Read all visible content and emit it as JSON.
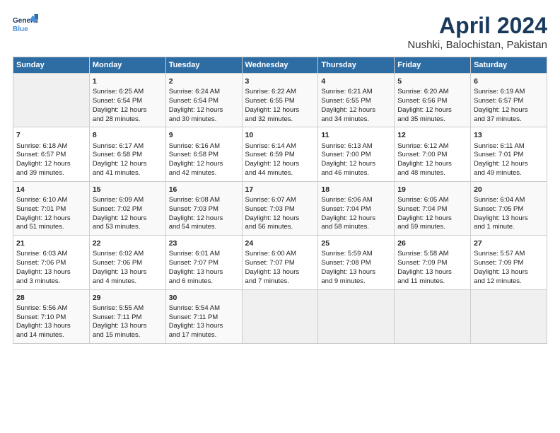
{
  "header": {
    "logo_line1": "General",
    "logo_line2": "Blue",
    "title": "April 2024",
    "subtitle": "Nushki, Balochistan, Pakistan"
  },
  "weekdays": [
    "Sunday",
    "Monday",
    "Tuesday",
    "Wednesday",
    "Thursday",
    "Friday",
    "Saturday"
  ],
  "weeks": [
    [
      {
        "day": "",
        "info": ""
      },
      {
        "day": "1",
        "info": "Sunrise: 6:25 AM\nSunset: 6:54 PM\nDaylight: 12 hours\nand 28 minutes."
      },
      {
        "day": "2",
        "info": "Sunrise: 6:24 AM\nSunset: 6:54 PM\nDaylight: 12 hours\nand 30 minutes."
      },
      {
        "day": "3",
        "info": "Sunrise: 6:22 AM\nSunset: 6:55 PM\nDaylight: 12 hours\nand 32 minutes."
      },
      {
        "day": "4",
        "info": "Sunrise: 6:21 AM\nSunset: 6:55 PM\nDaylight: 12 hours\nand 34 minutes."
      },
      {
        "day": "5",
        "info": "Sunrise: 6:20 AM\nSunset: 6:56 PM\nDaylight: 12 hours\nand 35 minutes."
      },
      {
        "day": "6",
        "info": "Sunrise: 6:19 AM\nSunset: 6:57 PM\nDaylight: 12 hours\nand 37 minutes."
      }
    ],
    [
      {
        "day": "7",
        "info": "Sunrise: 6:18 AM\nSunset: 6:57 PM\nDaylight: 12 hours\nand 39 minutes."
      },
      {
        "day": "8",
        "info": "Sunrise: 6:17 AM\nSunset: 6:58 PM\nDaylight: 12 hours\nand 41 minutes."
      },
      {
        "day": "9",
        "info": "Sunrise: 6:16 AM\nSunset: 6:58 PM\nDaylight: 12 hours\nand 42 minutes."
      },
      {
        "day": "10",
        "info": "Sunrise: 6:14 AM\nSunset: 6:59 PM\nDaylight: 12 hours\nand 44 minutes."
      },
      {
        "day": "11",
        "info": "Sunrise: 6:13 AM\nSunset: 7:00 PM\nDaylight: 12 hours\nand 46 minutes."
      },
      {
        "day": "12",
        "info": "Sunrise: 6:12 AM\nSunset: 7:00 PM\nDaylight: 12 hours\nand 48 minutes."
      },
      {
        "day": "13",
        "info": "Sunrise: 6:11 AM\nSunset: 7:01 PM\nDaylight: 12 hours\nand 49 minutes."
      }
    ],
    [
      {
        "day": "14",
        "info": "Sunrise: 6:10 AM\nSunset: 7:01 PM\nDaylight: 12 hours\nand 51 minutes."
      },
      {
        "day": "15",
        "info": "Sunrise: 6:09 AM\nSunset: 7:02 PM\nDaylight: 12 hours\nand 53 minutes."
      },
      {
        "day": "16",
        "info": "Sunrise: 6:08 AM\nSunset: 7:03 PM\nDaylight: 12 hours\nand 54 minutes."
      },
      {
        "day": "17",
        "info": "Sunrise: 6:07 AM\nSunset: 7:03 PM\nDaylight: 12 hours\nand 56 minutes."
      },
      {
        "day": "18",
        "info": "Sunrise: 6:06 AM\nSunset: 7:04 PM\nDaylight: 12 hours\nand 58 minutes."
      },
      {
        "day": "19",
        "info": "Sunrise: 6:05 AM\nSunset: 7:04 PM\nDaylight: 12 hours\nand 59 minutes."
      },
      {
        "day": "20",
        "info": "Sunrise: 6:04 AM\nSunset: 7:05 PM\nDaylight: 13 hours\nand 1 minute."
      }
    ],
    [
      {
        "day": "21",
        "info": "Sunrise: 6:03 AM\nSunset: 7:06 PM\nDaylight: 13 hours\nand 3 minutes."
      },
      {
        "day": "22",
        "info": "Sunrise: 6:02 AM\nSunset: 7:06 PM\nDaylight: 13 hours\nand 4 minutes."
      },
      {
        "day": "23",
        "info": "Sunrise: 6:01 AM\nSunset: 7:07 PM\nDaylight: 13 hours\nand 6 minutes."
      },
      {
        "day": "24",
        "info": "Sunrise: 6:00 AM\nSunset: 7:07 PM\nDaylight: 13 hours\nand 7 minutes."
      },
      {
        "day": "25",
        "info": "Sunrise: 5:59 AM\nSunset: 7:08 PM\nDaylight: 13 hours\nand 9 minutes."
      },
      {
        "day": "26",
        "info": "Sunrise: 5:58 AM\nSunset: 7:09 PM\nDaylight: 13 hours\nand 11 minutes."
      },
      {
        "day": "27",
        "info": "Sunrise: 5:57 AM\nSunset: 7:09 PM\nDaylight: 13 hours\nand 12 minutes."
      }
    ],
    [
      {
        "day": "28",
        "info": "Sunrise: 5:56 AM\nSunset: 7:10 PM\nDaylight: 13 hours\nand 14 minutes."
      },
      {
        "day": "29",
        "info": "Sunrise: 5:55 AM\nSunset: 7:11 PM\nDaylight: 13 hours\nand 15 minutes."
      },
      {
        "day": "30",
        "info": "Sunrise: 5:54 AM\nSunset: 7:11 PM\nDaylight: 13 hours\nand 17 minutes."
      },
      {
        "day": "",
        "info": ""
      },
      {
        "day": "",
        "info": ""
      },
      {
        "day": "",
        "info": ""
      },
      {
        "day": "",
        "info": ""
      }
    ]
  ]
}
